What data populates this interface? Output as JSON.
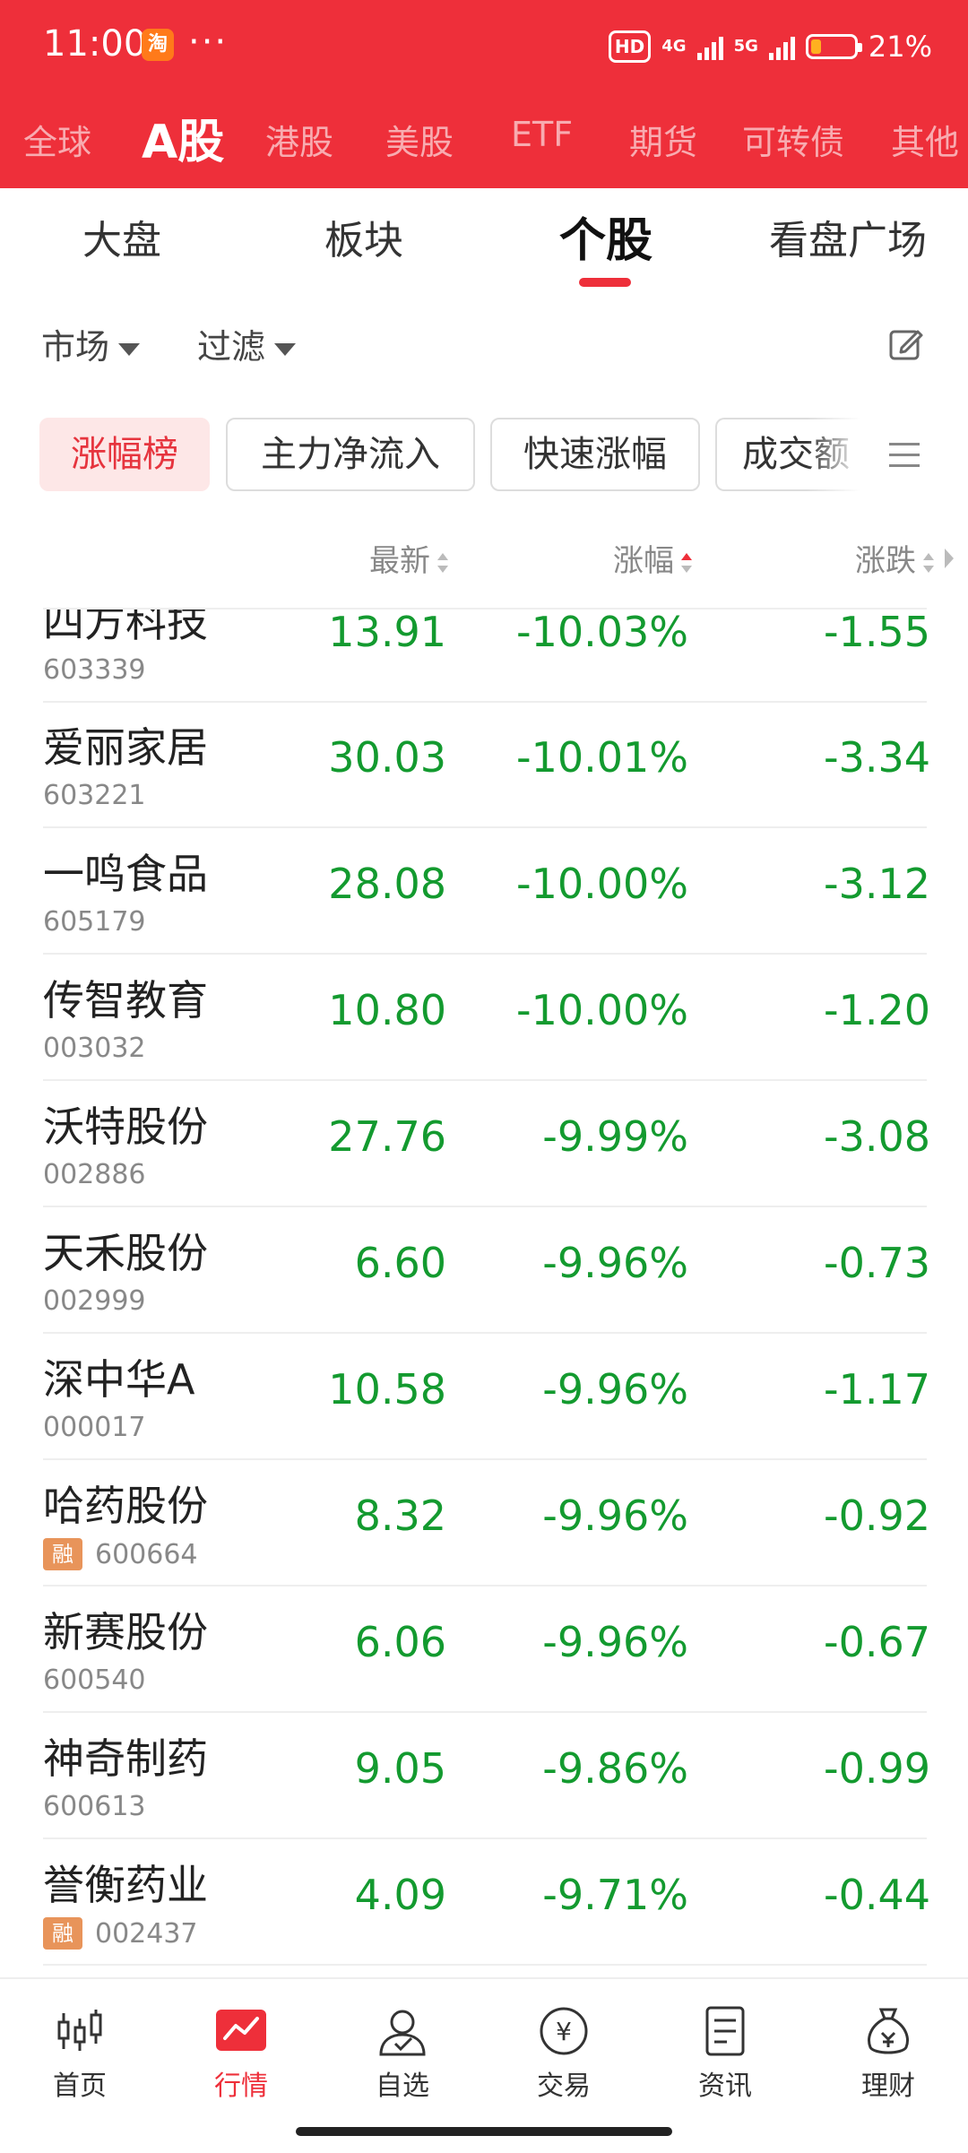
{
  "status": {
    "time": "11:00",
    "app_icon": "淘",
    "more": "···",
    "hd": "HD",
    "net_4g": "4G",
    "net_5g": "5G",
    "battery_pct": "21%",
    "battery_level": 0.21
  },
  "market_tabs": [
    "全球",
    "A股",
    "港股",
    "美股",
    "ETF",
    "期货",
    "可转债",
    "其他"
  ],
  "active_market_tab": "A股",
  "sub_tabs": [
    "大盘",
    "板块",
    "个股",
    "看盘广场"
  ],
  "active_sub_tab": "个股",
  "filters": {
    "market": "市场",
    "filter": "过滤"
  },
  "chips": [
    "涨幅榜",
    "主力净流入",
    "快速涨幅",
    "成交额"
  ],
  "columns": {
    "latest": "最新",
    "change_pct": "涨幅",
    "change": "涨跌"
  },
  "stocks": [
    {
      "name": "四方科技",
      "code": "603339",
      "price": "13.91",
      "pct": "-10.03%",
      "chg": "-1.55",
      "margin": false
    },
    {
      "name": "爱丽家居",
      "code": "603221",
      "price": "30.03",
      "pct": "-10.01%",
      "chg": "-3.34",
      "margin": false
    },
    {
      "name": "一鸣食品",
      "code": "605179",
      "price": "28.08",
      "pct": "-10.00%",
      "chg": "-3.12",
      "margin": false
    },
    {
      "name": "传智教育",
      "code": "003032",
      "price": "10.80",
      "pct": "-10.00%",
      "chg": "-1.20",
      "margin": false
    },
    {
      "name": "沃特股份",
      "code": "002886",
      "price": "27.76",
      "pct": "-9.99%",
      "chg": "-3.08",
      "margin": false
    },
    {
      "name": "天禾股份",
      "code": "002999",
      "price": "6.60",
      "pct": "-9.96%",
      "chg": "-0.73",
      "margin": false
    },
    {
      "name": "深中华A",
      "code": "000017",
      "price": "10.58",
      "pct": "-9.96%",
      "chg": "-1.17",
      "margin": false
    },
    {
      "name": "哈药股份",
      "code": "600664",
      "price": "8.32",
      "pct": "-9.96%",
      "chg": "-0.92",
      "margin": true
    },
    {
      "name": "新赛股份",
      "code": "600540",
      "price": "6.06",
      "pct": "-9.96%",
      "chg": "-0.67",
      "margin": false
    },
    {
      "name": "神奇制药",
      "code": "600613",
      "price": "9.05",
      "pct": "-9.86%",
      "chg": "-0.99",
      "margin": false
    },
    {
      "name": "誉衡药业",
      "code": "002437",
      "price": "4.09",
      "pct": "-9.71%",
      "chg": "-0.44",
      "margin": true
    }
  ],
  "margin_badge": "融",
  "bottom_nav": [
    "首页",
    "行情",
    "自选",
    "交易",
    "资讯",
    "理财"
  ],
  "active_nav": "行情",
  "colors": {
    "header_red": "#ee2f3a",
    "down_green": "#139a2f",
    "chip_active_bg": "#fde7e7",
    "margin_badge": "#e8945a"
  },
  "icons": {
    "edit": "edit-icon",
    "menu": "menu-icon",
    "sort": "sort-icon"
  }
}
